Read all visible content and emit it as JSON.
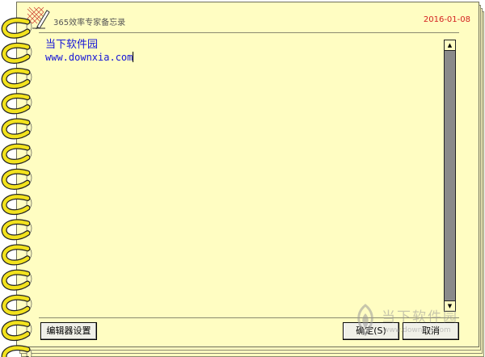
{
  "window": {
    "title": "365效率专家备忘录",
    "date": "2016-01-08"
  },
  "editor": {
    "lines": [
      "当下软件园",
      "www.downxia.com"
    ]
  },
  "buttons": {
    "settings": "编辑器设置",
    "ok": "确定(S)",
    "cancel": "取消"
  },
  "watermark": {
    "name": "当下软件园",
    "url": "www.downxia.com"
  },
  "colors": {
    "paper": "#fffdc2",
    "text": "#1515d8",
    "date": "#d42020",
    "ring": "#f2e21d"
  }
}
